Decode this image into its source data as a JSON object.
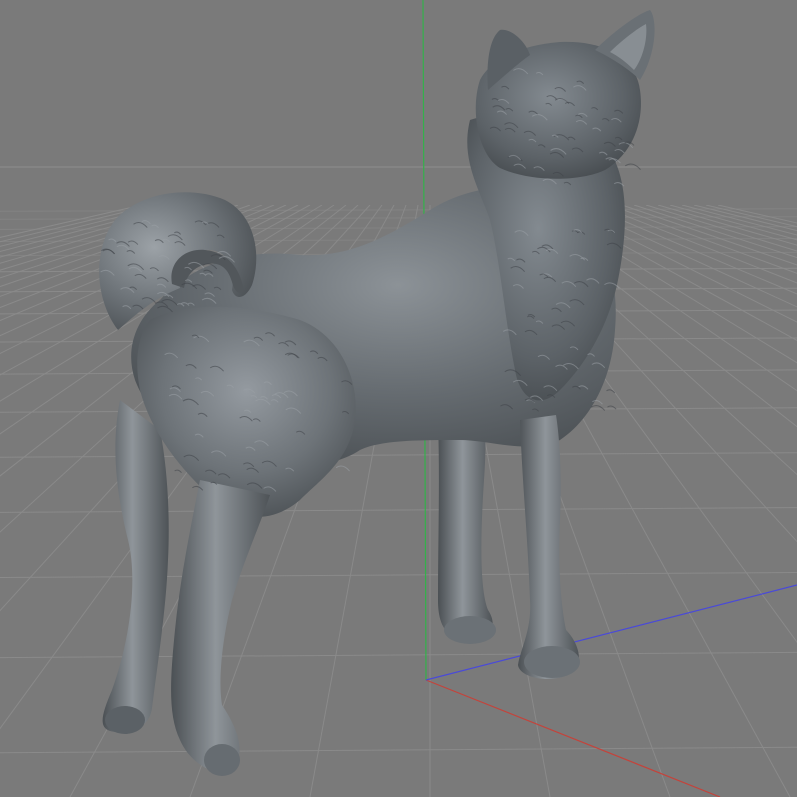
{
  "viewport": {
    "name": "3d-perspective-viewport",
    "colors": {
      "background": "#7a7a7a",
      "horizon_line": "#8e8e8e",
      "grid_line": "#8a8a8a",
      "grid_line_far": "#838383",
      "axis_x": "#c4433b",
      "axis_y": "#33b14a",
      "axis_z": "#4a4ad8",
      "model_base": "#5f6468",
      "model_highlight": "#a7acb0",
      "model_shadow": "#3f4347"
    }
  },
  "scene": {
    "object": {
      "name": "dog-sculpt-model",
      "description_icon": "dog-model"
    }
  }
}
